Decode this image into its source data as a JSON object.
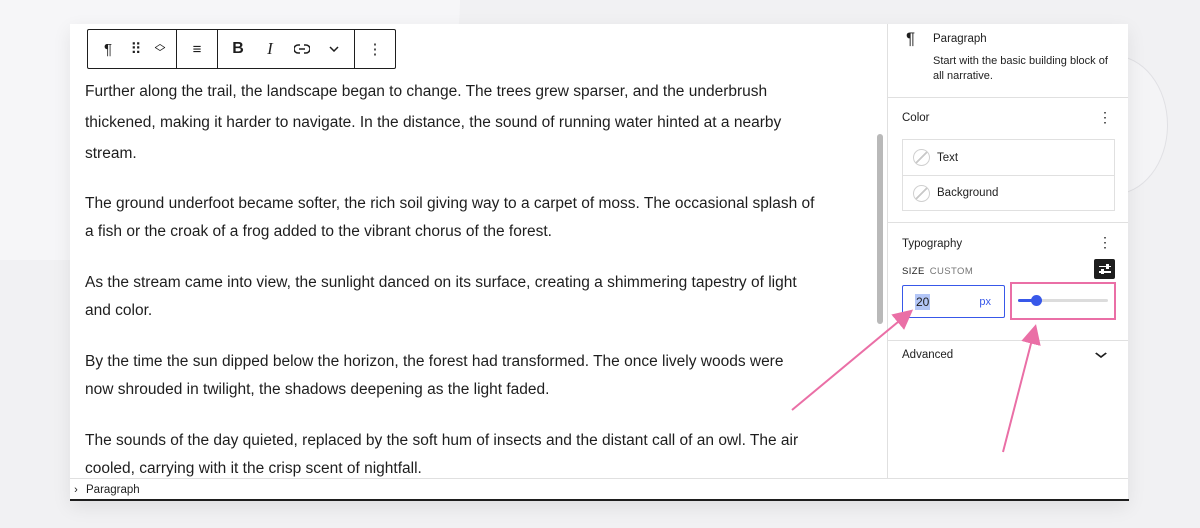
{
  "toolbar": {
    "paragraph_icon": "¶",
    "drag_icon": "⠿",
    "move_icon": "⌃⌄",
    "align_icon": "≡",
    "bold_label": "B",
    "italic_label": "I",
    "link_icon": "⊂⊃",
    "more_icon": "⌄",
    "options_icon": "⋮"
  },
  "content": {
    "paragraphs": [
      "Further along the trail, the landscape began to change. The trees grew sparser, and the underbrush thickened, making it harder to navigate. In the distance, the sound of running water hinted at a nearby stream.",
      "The ground underfoot became softer, the rich soil giving way to a carpet of moss. The occasional splash of a fish or the croak of a frog added to the vibrant chorus of the forest.",
      "As the stream came into view, the sunlight danced on its surface, creating a shimmering tapestry of light and color.",
      "By the time the sun dipped below the horizon, the forest had transformed. The once lively woods were now shrouded in twilight, the shadows deepening as the light faded.",
      "The sounds of the day quieted, replaced by the soft hum of insects and the distant call of an owl. The air cooled, carrying with it the crisp scent of nightfall."
    ]
  },
  "footer": {
    "chevron": "›",
    "breadcrumb": "Paragraph"
  },
  "sidebar": {
    "block": {
      "icon": "¶",
      "title": "Paragraph",
      "description": "Start with the basic building block of all narrative."
    },
    "color": {
      "title": "Color",
      "menu_icon": "⋮",
      "items": [
        "Text",
        "Background"
      ]
    },
    "typography": {
      "title": "Typography",
      "menu_icon": "⋮",
      "size_label": "SIZE",
      "size_sub": "CUSTOM",
      "value": "20",
      "unit": "px",
      "slider_fraction": 0.2
    },
    "advanced": {
      "title": "Advanced",
      "chevron": "⌄"
    }
  },
  "colors": {
    "accent": "#3858e9",
    "annotation": "#ea6fa6"
  }
}
